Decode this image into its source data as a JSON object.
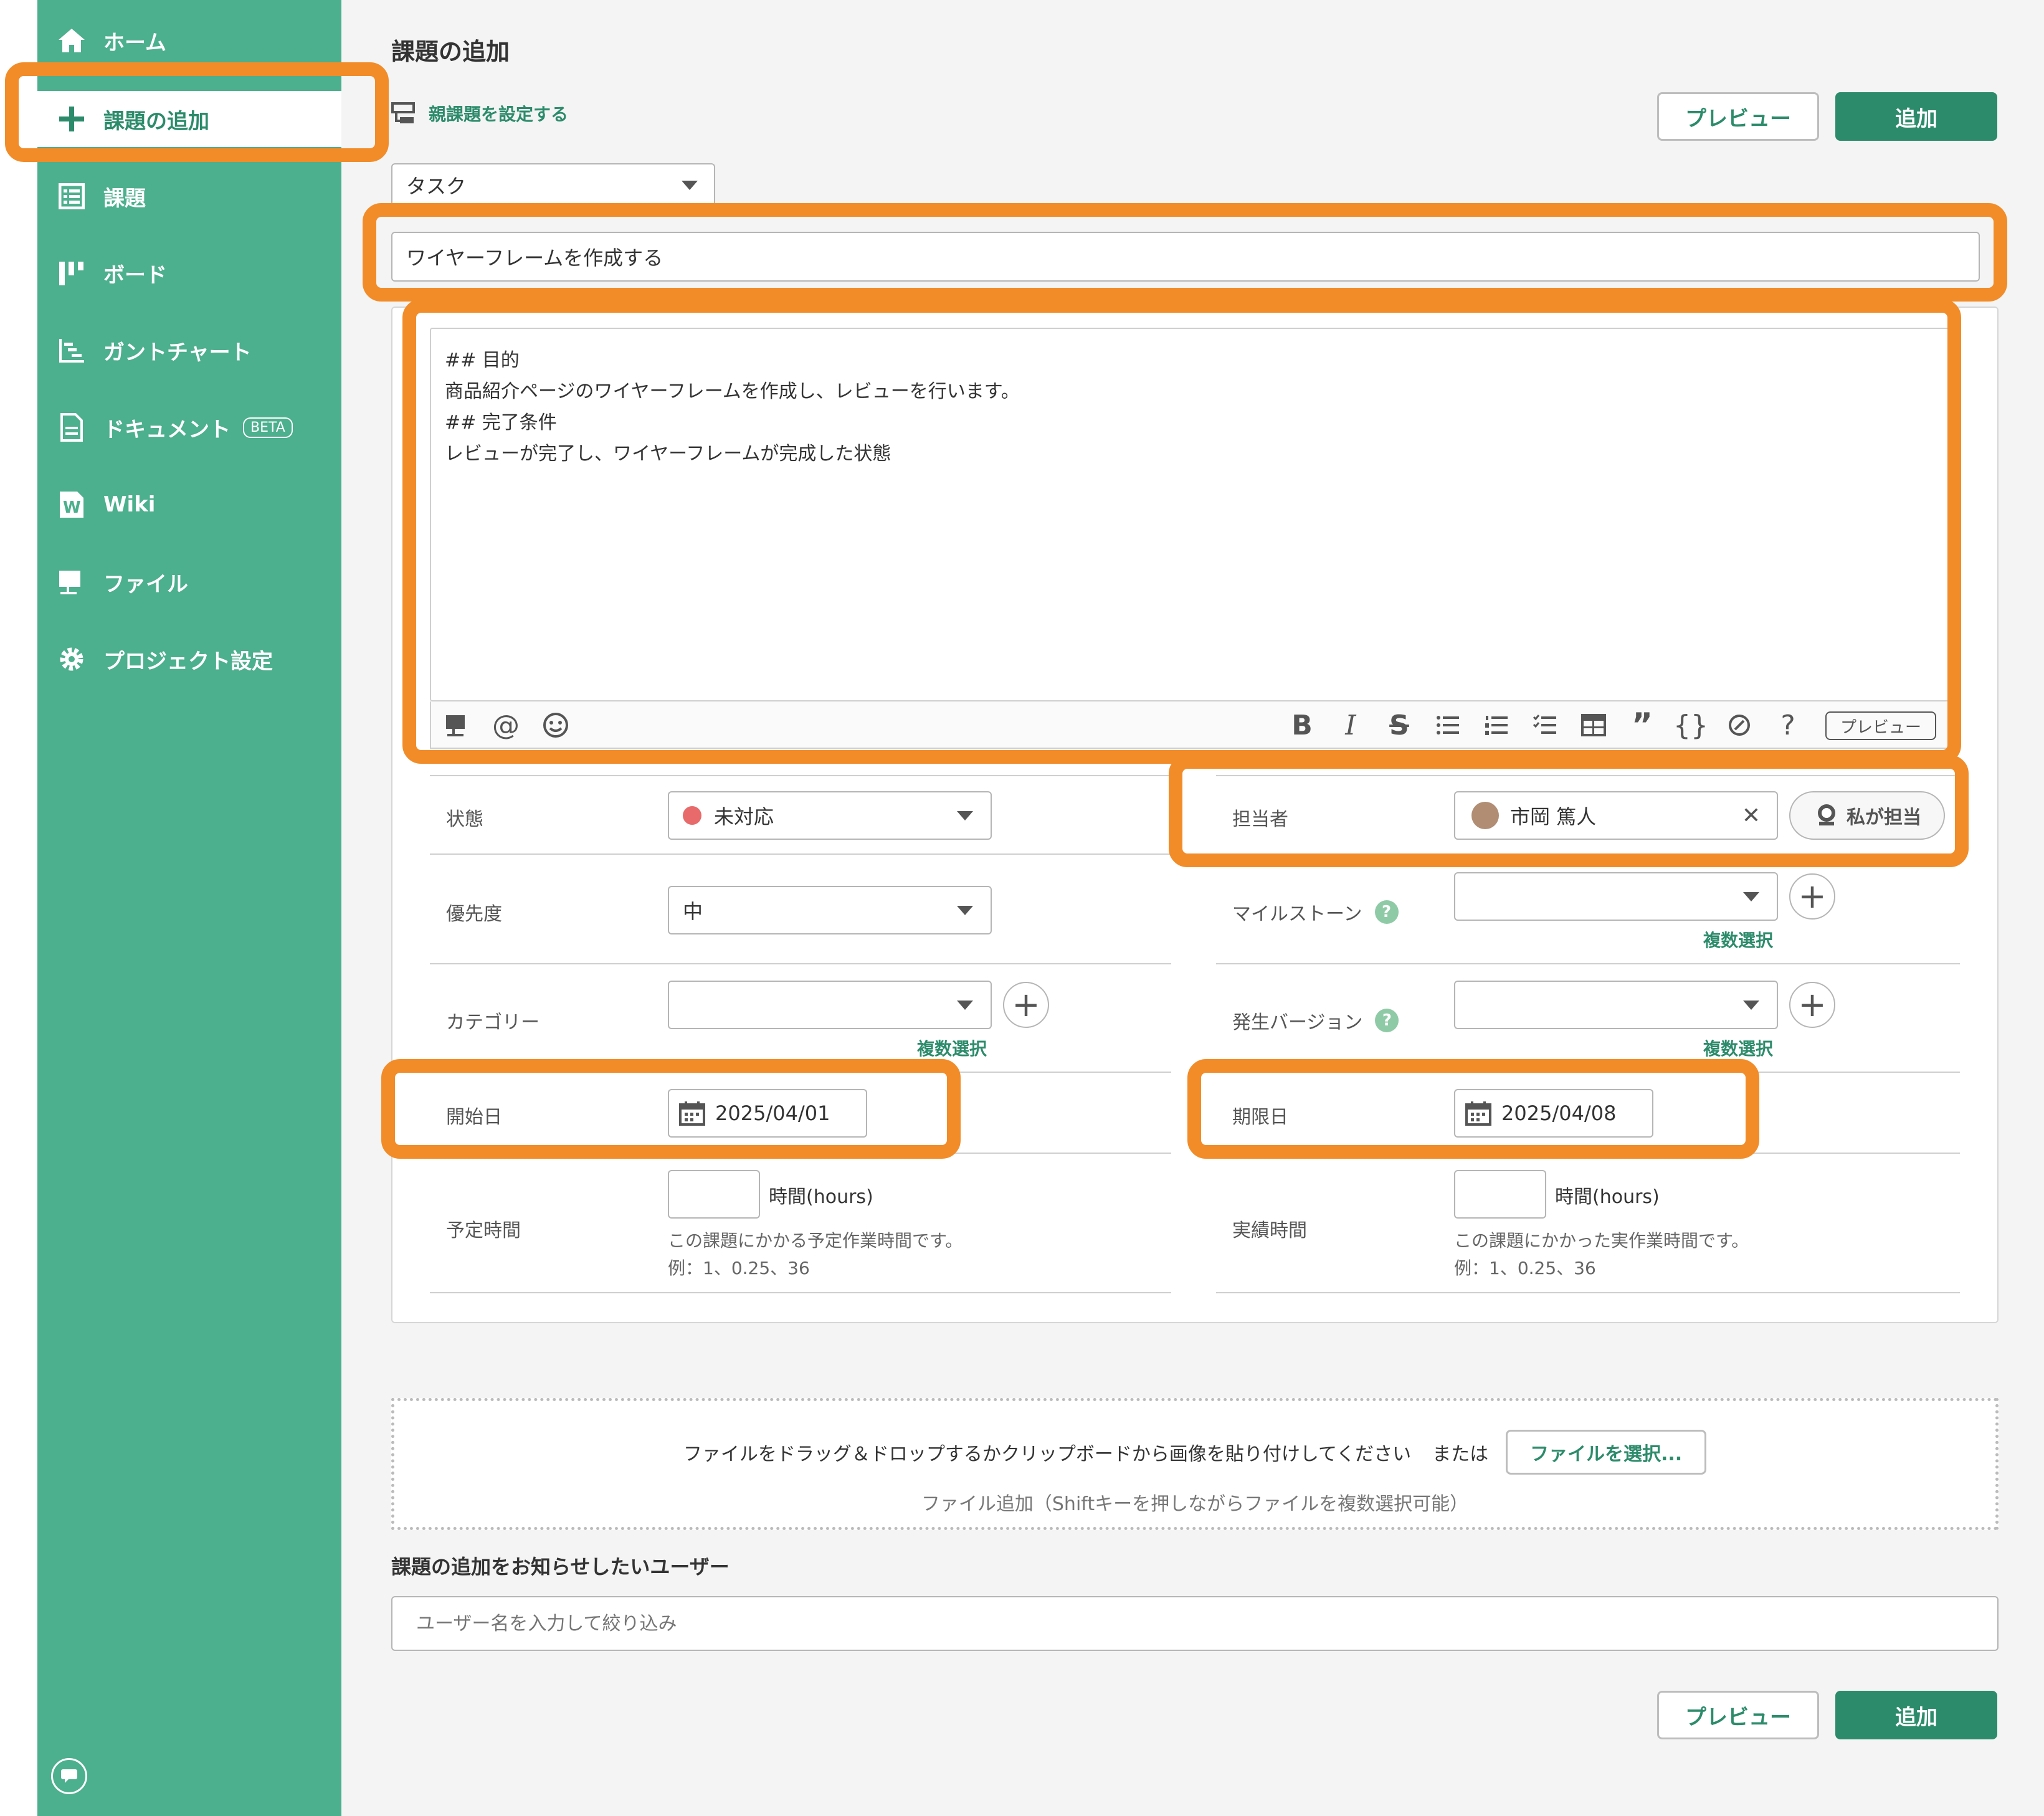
{
  "sidebar": {
    "items": [
      {
        "label": "ホーム",
        "icon": "home-icon"
      },
      {
        "label": "課題の追加",
        "icon": "plus-icon"
      },
      {
        "label": "課題",
        "icon": "list-icon"
      },
      {
        "label": "ボード",
        "icon": "board-icon"
      },
      {
        "label": "ガントチャート",
        "icon": "gantt-icon"
      },
      {
        "label": "ドキュメント",
        "icon": "document-icon",
        "badge": "BETA"
      },
      {
        "label": "Wiki",
        "icon": "wiki-icon"
      },
      {
        "label": "ファイル",
        "icon": "file-icon"
      },
      {
        "label": "プロジェクト設定",
        "icon": "gear-icon"
      }
    ]
  },
  "header": {
    "title": "課題の追加",
    "parent_link": "親課題を設定する",
    "preview_label": "プレビュー",
    "add_label": "追加"
  },
  "form": {
    "issue_type": "タスク",
    "subject": "ワイヤーフレームを作成する",
    "description": [
      "## 目的",
      "商品紹介ページのワイヤーフレームを作成し、レビューを行います。",
      "## 完了条件",
      "レビューが完了し、ワイヤーフレームが完成した状態"
    ],
    "editor_preview_label": "プレビュー",
    "fields": {
      "status": {
        "label": "状態",
        "value": "未対応",
        "dot_color": "#e86a6a"
      },
      "assignee": {
        "label": "担当者",
        "value": "市岡 篤人",
        "self_assign_label": "私が担当"
      },
      "priority": {
        "label": "優先度",
        "value": "中"
      },
      "milestone": {
        "label": "マイルストーン",
        "value": "",
        "multi_label": "複数選択"
      },
      "category": {
        "label": "カテゴリー",
        "value": "",
        "multi_label": "複数選択"
      },
      "version": {
        "label": "発生バージョン",
        "value": "",
        "multi_label": "複数選択"
      },
      "start_date": {
        "label": "開始日",
        "value": "2025/04/01"
      },
      "due_date": {
        "label": "期限日",
        "value": "2025/04/08"
      },
      "estimated_hours": {
        "label": "予定時間",
        "unit": "時間(hours)",
        "help": "この課題にかかる予定作業時間です。",
        "example": "例：1、0.25、36"
      },
      "actual_hours": {
        "label": "実績時間",
        "unit": "時間(hours)",
        "help": "この課題にかかった実作業時間です。",
        "example": "例：1、0.25、36"
      }
    }
  },
  "attachments": {
    "drop_text": "ファイルをドラッグ＆ドロップするかクリップボードから画像を貼り付けしてください",
    "or_text": "または",
    "select_button": "ファイルを選択...",
    "hint": "ファイル追加（Shiftキーを押しながらファイルを複数選択可能）"
  },
  "notify": {
    "title": "課題の追加をお知らせしたいユーザー",
    "placeholder": "ユーザー名を入力して絞り込み"
  },
  "colors": {
    "sidebar": "#4caf8d",
    "primary": "#2c8b6b",
    "highlight": "#f28c28"
  }
}
